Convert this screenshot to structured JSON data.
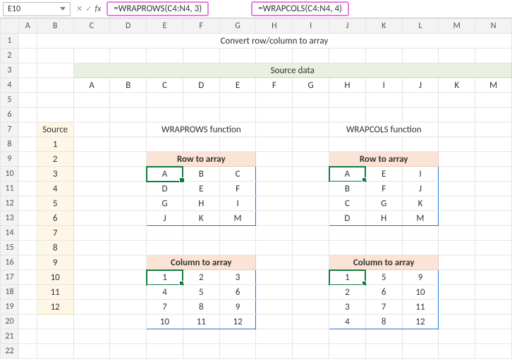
{
  "namebox": "E10",
  "formula1": "=WRAPROWS(C4:N4, 3)",
  "formula2": "=WRAPCOLS(C4:N4, 4)",
  "cols": [
    "A",
    "B",
    "C",
    "D",
    "E",
    "F",
    "G",
    "H",
    "I",
    "J",
    "K",
    "L",
    "M",
    "N"
  ],
  "rows": [
    "1",
    "2",
    "3",
    "4",
    "5",
    "6",
    "7",
    "8",
    "9",
    "10",
    "11",
    "12",
    "13",
    "14",
    "15",
    "16",
    "17",
    "18",
    "19",
    "20",
    "21",
    "22"
  ],
  "title": "Convert row/column to array",
  "sourceHeader": "Source data",
  "sourceRow": [
    "A",
    "B",
    "C",
    "D",
    "E",
    "F",
    "G",
    "H",
    "I",
    "J",
    "K",
    "M"
  ],
  "sourceColHeader": "Source",
  "sourceCol": [
    "1",
    "2",
    "3",
    "4",
    "5",
    "6",
    "7",
    "8",
    "9",
    "10",
    "11",
    "12"
  ],
  "fnLeft": "WRAPROWS function",
  "fnRight": "WRAPCOLS function",
  "rowToArrLabel": "Row to array",
  "colToArrLabel": "Column to array",
  "leftRowArr": [
    [
      "A",
      "B",
      "C"
    ],
    [
      "D",
      "E",
      "F"
    ],
    [
      "G",
      "H",
      "I"
    ],
    [
      "J",
      "K",
      "M"
    ]
  ],
  "rightRowArr": [
    [
      "A",
      "E",
      "I"
    ],
    [
      "B",
      "F",
      "J"
    ],
    [
      "C",
      "G",
      "K"
    ],
    [
      "D",
      "H",
      "M"
    ]
  ],
  "leftColArr": [
    [
      "1",
      "2",
      "3"
    ],
    [
      "4",
      "5",
      "6"
    ],
    [
      "7",
      "8",
      "9"
    ],
    [
      "10",
      "11",
      "12"
    ]
  ],
  "rightColArr": [
    [
      "1",
      "5",
      "9"
    ],
    [
      "2",
      "6",
      "10"
    ],
    [
      "3",
      "7",
      "11"
    ],
    [
      "4",
      "8",
      "12"
    ]
  ]
}
